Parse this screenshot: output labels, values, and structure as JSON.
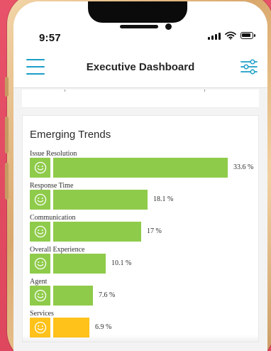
{
  "status_bar": {
    "time": "9:57"
  },
  "header": {
    "title": "Executive Dashboard"
  },
  "icons": {
    "menu": "menu-icon",
    "filter": "sliders-icon",
    "signal": "signal-icon",
    "wifi": "wifi-icon",
    "battery": "battery-icon",
    "smile": "smile-icon"
  },
  "colors": {
    "accent": "#1b9ec7",
    "positive": "#8fcb4a",
    "neutral": "#ffc21a"
  },
  "trends": {
    "title": "Emerging Trends",
    "max_percent": 33.6,
    "items": [
      {
        "label": "Issue Resolution",
        "value": 33.6,
        "value_text": "33.6 %",
        "color": "#8fcb4a"
      },
      {
        "label": "Response Time",
        "value": 18.1,
        "value_text": "18.1 %",
        "color": "#8fcb4a"
      },
      {
        "label": "Communication",
        "value": 17,
        "value_text": "17 %",
        "color": "#8fcb4a"
      },
      {
        "label": "Overall Experience",
        "value": 10.1,
        "value_text": "10.1 %",
        "color": "#8fcb4a"
      },
      {
        "label": "Agent",
        "value": 7.6,
        "value_text": "7.6 %",
        "color": "#8fcb4a"
      },
      {
        "label": "Services",
        "value": 6.9,
        "value_text": "6.9 %",
        "color": "#ffc21a"
      }
    ]
  }
}
